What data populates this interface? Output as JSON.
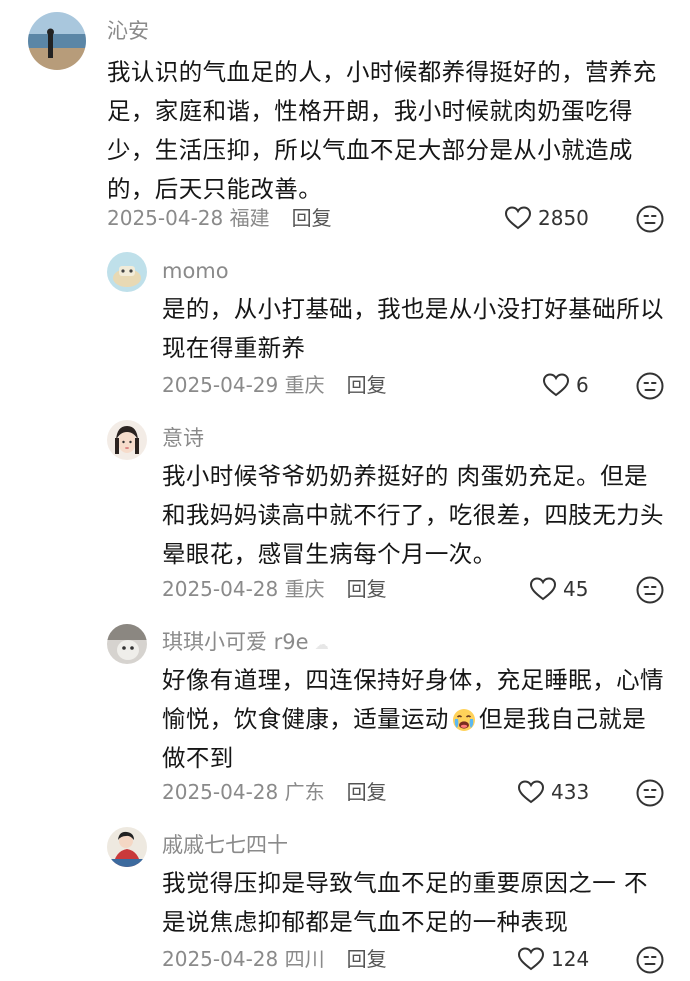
{
  "comments": [
    {
      "name": "沁安",
      "lines": [
        "我认识的气血足的人，小时候都养得挺好的，营养充",
        "足，家庭和谐，性格开朗，我小时候就肉奶蛋吃得",
        "少，生活压抑，所以气血不足大部分是从小就造成",
        "的，后天只能改善。"
      ],
      "date_location": "2025-04-28 福建",
      "reply_label": "回复",
      "likes": "2850"
    },
    {
      "name": "momo",
      "lines": [
        "是的，从小打基础，我也是从小没打好基础所以",
        "现在得重新养"
      ],
      "date_location": "2025-04-29 重庆",
      "reply_label": "回复",
      "likes": "6"
    },
    {
      "name": "意诗",
      "lines": [
        "我小时候爷爷奶奶养挺好的 肉蛋奶充足。但是",
        "和我妈妈读高中就不行了，吃很差，四肢无力头",
        "晕眼花，感冒生病每个月一次。"
      ],
      "date_location": "2025-04-28 重庆",
      "reply_label": "回复",
      "likes": "45"
    },
    {
      "name": "琪琪小可爱 r9e",
      "lines": [
        "好像有道理，四连保持好身体，充足睡眠，心情",
        "愉悦，饮食健康，适量运动",
        "但是我自己就是",
        "做不到"
      ],
      "date_location": "2025-04-28 广东",
      "reply_label": "回复",
      "likes": "433"
    },
    {
      "name": "戚戚七七四十",
      "lines": [
        "我觉得压抑是导致气血不足的重要原因之一 不",
        "是说焦虑抑郁都是气血不足的一种表现"
      ],
      "date_location": "2025-04-28 四川",
      "reply_label": "回复",
      "likes": "124"
    }
  ],
  "icons": {
    "like": "heart-outline-icon",
    "dislike": "neutral-face-icon",
    "inline_emoji": "crying-face-emoji"
  },
  "colors": {
    "username": "#8a8a8a",
    "text": "#161616",
    "meta": "#8a8a8a"
  }
}
